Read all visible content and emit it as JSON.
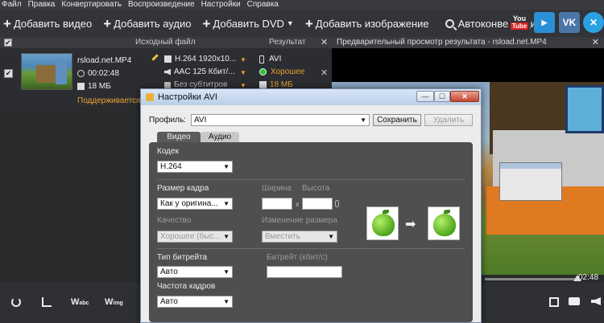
{
  "menu": [
    "Файл",
    "Правка",
    "Конвертировать",
    "Воспроизведение",
    "Настройки",
    "Справка"
  ],
  "toolbar": {
    "add_video": "Добавить видео",
    "add_audio": "Добавить аудио",
    "add_dvd": "Добавить DVD",
    "add_image": "Добавить изображение",
    "autoconvert": "Автоконвертация",
    "youtube_top": "You",
    "youtube_bottom": "Tube",
    "vk": "VK"
  },
  "list": {
    "header_source": "Исходный файл",
    "header_result": "Результат",
    "file": {
      "name": "rsload.net.MP4",
      "duration": "00:02:48",
      "size": "18 МБ",
      "supported": "Поддерживается",
      "video_codec": "H.264 1920x10...",
      "audio_codec": "AAC 125 Кбит/...",
      "subtitles": "Без субтитров",
      "result_format": "AVI",
      "result_quality": "Хорошее",
      "result_size": "18 МБ"
    }
  },
  "preview": {
    "title": "Предварительный просмотр результата - rsload.net.MP4",
    "time": "02:48"
  },
  "dialog": {
    "title": "Настройки AVI",
    "profile_label": "Профиль:",
    "profile_value": "AVI",
    "save_label": "Сохранить",
    "delete_label": "Удалить",
    "tab_video": "Видео",
    "tab_audio": "Аудио",
    "codec_label": "Кодек",
    "codec_value": "H.264",
    "frame_size_label": "Размер кадра",
    "frame_size_value": "Как у оригина...",
    "width_label": "Ширина",
    "height_label": "Высота",
    "quality_label": "Качество",
    "quality_value": "Хорошее (быс...",
    "resize_label": "Изменение размера",
    "resize_value": "Вместить",
    "bitrate_type_label": "Тип битрейта",
    "bitrate_type_value": "Авто",
    "bitrate_label": "Битрейт (кбит/с)",
    "framerate_label": "Частота кадров",
    "framerate_value": "Авто",
    "times_sign": "x"
  },
  "bottom": {
    "watermark_text": "W",
    "watermark_sub1": "abc",
    "watermark_sub2": "img"
  },
  "colors": {
    "accent": "#e8a12e",
    "good": "#2fbf3a",
    "panel": "#4e4f51"
  }
}
